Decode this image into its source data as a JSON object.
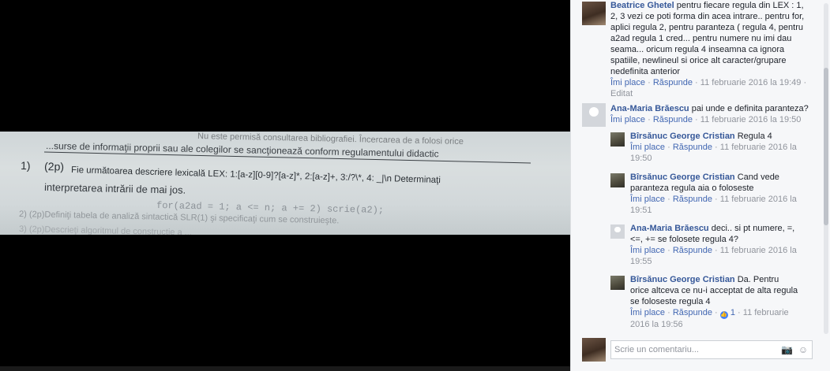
{
  "photo": {
    "line0": "...surse de informaţii proprii sau ale colegilor se sancţionează conform regulamentului didactic",
    "line_header": "Nu este permisă consultarea bibliografiei. Încercarea de a folosi orice",
    "q1_num": "1)",
    "q1_pts": "(2p)",
    "q1_text": "Fie următoarea descriere lexicală LEX: 1:[a-z][0-9]?[a-z]*, 2:[a-z]+, 3:/?\\*, 4: _|\\n Determinaţi",
    "q1_text2": "interpretarea intrării de mai jos.",
    "code": "for(a2ad = 1; a <= n; a += 2) scrie(a2);",
    "q2": "2)   (2p)Definiţi tabela de analiză sintactică SLR(1) şi specificaţi cum se construieşte.",
    "q3": "3)   (2p)Descrieţi algoritmul de construcţie a ..."
  },
  "comments": [
    {
      "author": "Beatrice Ghetel",
      "text": "pentru fiecare regula din LEX : 1, 2, 3 vezi ce poti forma din acea intrare.. pentru for, aplici regula 2, pentru paranteza ( regula 4, pentru a2ad regula 1 cred... pentru numere nu imi dau seama... oricum regula 4 inseamna ca ignora spatiile, newlineul si orice alt caracter/grupare nedefinita anterior",
      "like": "Îmi place",
      "reply": "Răspunde",
      "time": "11 februarie 2016 la 19:49",
      "edited": "Editat"
    },
    {
      "author": "Ana-Maria Brăescu",
      "text": "pai unde e definita paranteza?",
      "like": "Îmi place",
      "reply": "Răspunde",
      "time": "11 februarie 2016 la 19:50"
    }
  ],
  "replies": [
    {
      "author": "Bîrsănuc George Cristian",
      "text": "Regula 4",
      "like": "Îmi place",
      "reply": "Răspunde",
      "time": "11 februarie 2016 la 19:50"
    },
    {
      "author": "Bîrsănuc George Cristian",
      "text": "Cand vede paranteza regula aia o foloseste",
      "like": "Îmi place",
      "reply": "Răspunde",
      "time": "11 februarie 2016 la 19:51"
    },
    {
      "author": "Ana-Maria Brăescu",
      "text": "deci.. si pt numere, =, <=, += se folosete regula 4?",
      "like": "Îmi place",
      "reply": "Răspunde",
      "time": "11 februarie 2016 la 19:55"
    },
    {
      "author": "Bîrsănuc George Cristian",
      "text": "Da. Pentru orice altceva ce nu-i acceptat de alta regula se foloseste regula 4",
      "like": "Îmi place",
      "reply": "Răspunde",
      "reactions": "1",
      "time": "11 februarie 2016 la 19:56"
    }
  ],
  "composer": {
    "placeholder": "Scrie un comentariu..."
  },
  "colors": {
    "author": "#365899",
    "link": "#4267b2",
    "meta": "#90949c",
    "panel_bg": "#f6f7f9"
  }
}
